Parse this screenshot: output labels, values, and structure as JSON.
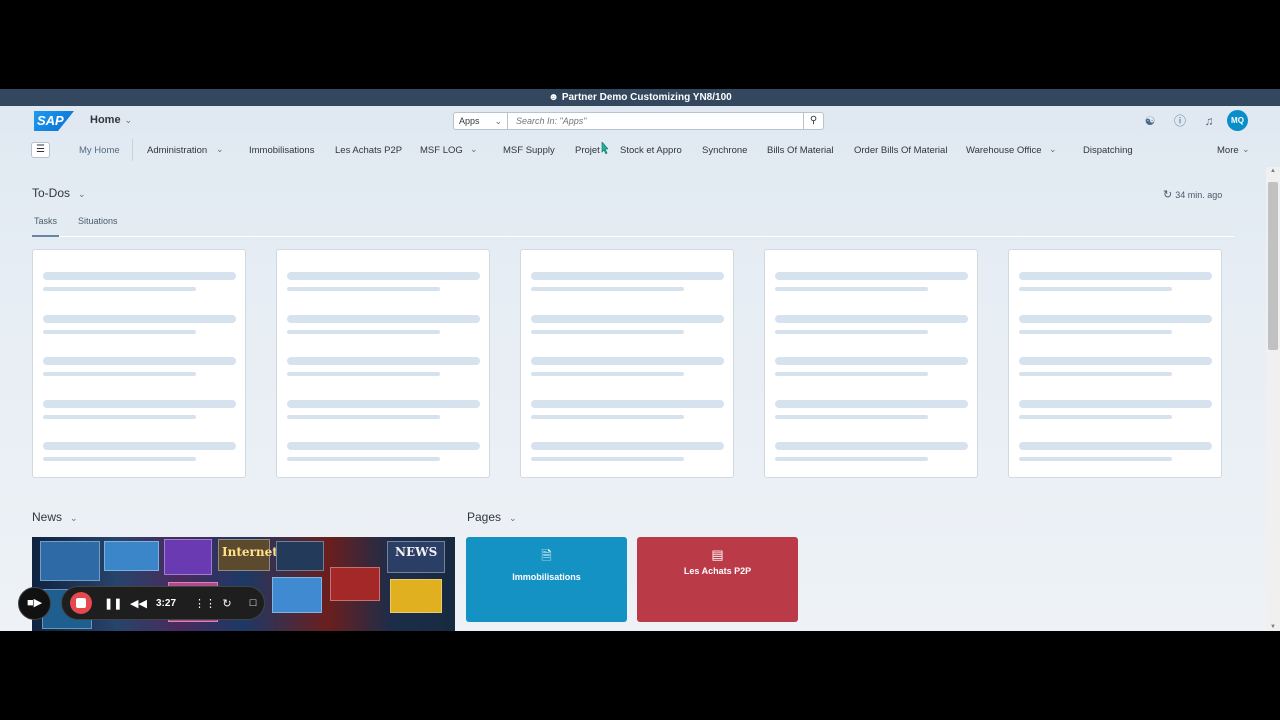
{
  "window_title": "Partner Demo Customizing YN8/100",
  "shell": {
    "logo": "SAP",
    "home_label": "Home",
    "search_scope": "Apps",
    "search_placeholder": "Search In: \"Apps\"",
    "avatar_initials": "MQ"
  },
  "nav": {
    "items": [
      "My Home",
      "Administration",
      "Immobilisations",
      "Les Achats P2P",
      "MSF LOG",
      "MSF Supply",
      "Projet",
      "Stock et Appro",
      "Synchrone",
      "Bills Of Material",
      "Order Bills Of Material",
      "Warehouse Office",
      "Dispatching"
    ],
    "more_label": "More"
  },
  "todos": {
    "title": "To-Dos",
    "refresh_label": "34 min. ago",
    "tabs": [
      "Tasks",
      "Situations"
    ]
  },
  "news": {
    "title": "News",
    "image_badges": [
      "Internet",
      "NEWS"
    ]
  },
  "pages": {
    "title": "Pages",
    "tiles": [
      {
        "label": "Immobilisations",
        "color": "#1592c4"
      },
      {
        "label": "Les Achats P2P",
        "color": "#bb3a48"
      }
    ]
  },
  "recorder": {
    "time": "3:27"
  },
  "colors": {
    "title_bar": "#33475e",
    "accent": "#0a6ed1"
  },
  "icons": {
    "title": "user-group-icon",
    "search": "search-icon",
    "help": "help-icon",
    "notifications": "bell-icon",
    "refresh": "refresh-icon"
  }
}
